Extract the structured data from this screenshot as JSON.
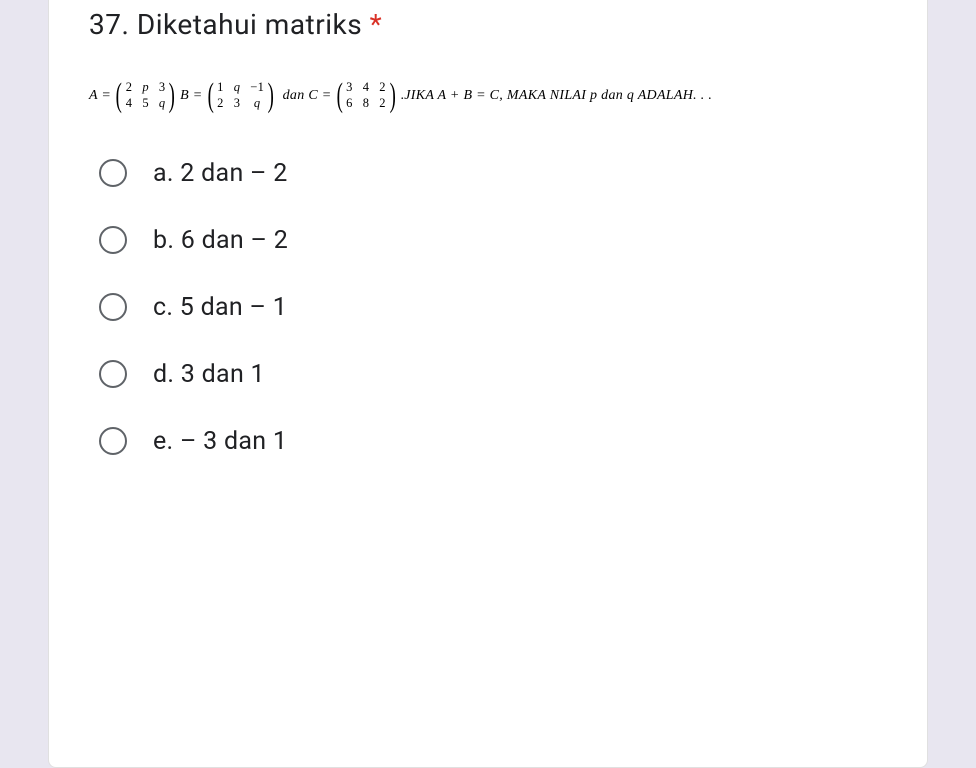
{
  "question": {
    "number": "37.",
    "title": "Diketahui  matriks",
    "required_mark": "*"
  },
  "math": {
    "A_eq": "A =",
    "A": [
      "2",
      "p",
      "3",
      "4",
      "5",
      "q"
    ],
    "B_eq": "B =",
    "B": [
      "1",
      "q",
      "−1",
      "2",
      "3",
      "q"
    ],
    "dan": "dan",
    "C_eq": "C =",
    "C": [
      "3",
      "4",
      "2",
      "6",
      "8",
      "2"
    ],
    "period": ".",
    "tail": " JIKA A + B = C, MAKA NILAI p dan q ADALAH. . ."
  },
  "options": [
    {
      "label": "a. 2 dan – 2"
    },
    {
      "label": "b. 6 dan – 2"
    },
    {
      "label": "c. 5 dan – 1"
    },
    {
      "label": "d. 3 dan 1"
    },
    {
      "label": "e. – 3 dan 1"
    }
  ]
}
